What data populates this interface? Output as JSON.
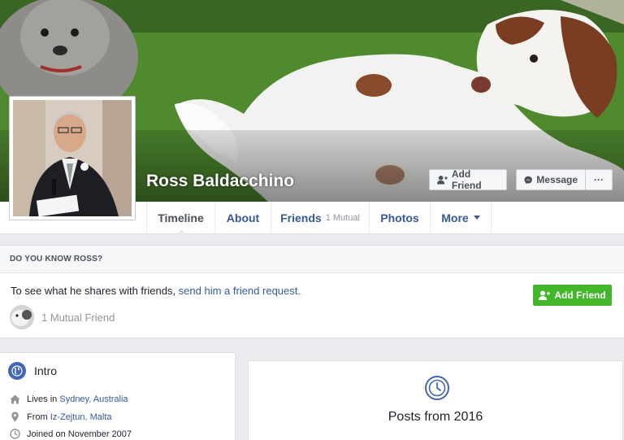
{
  "profile": {
    "name": "Ross Baldacchino"
  },
  "cover_actions": {
    "add_friend": "Add Friend",
    "message": "Message",
    "more": "···"
  },
  "tabs": [
    {
      "label": "Timeline",
      "sub": ""
    },
    {
      "label": "About",
      "sub": ""
    },
    {
      "label": "Friends",
      "sub": "1 Mutual"
    },
    {
      "label": "Photos",
      "sub": ""
    },
    {
      "label": "More",
      "sub": ""
    }
  ],
  "know_panel": {
    "heading": "DO YOU KNOW ROSS?",
    "text_prefix": "To see what he shares with friends, ",
    "link": "send him a friend request.",
    "mutual": "1 Mutual Friend",
    "add_friend": "Add Friend"
  },
  "intro": {
    "title": "Intro",
    "lives_prefix": "Lives in ",
    "lives_link": "Sydney, Australia",
    "from_prefix": "From ",
    "from_link": "Iz-Zejtun, Malta",
    "joined": "Joined on November 2007"
  },
  "posts": {
    "title": "Posts from 2016"
  },
  "colors": {
    "brand": "#4267b2",
    "link": "#365899",
    "green": "#42b72a"
  }
}
